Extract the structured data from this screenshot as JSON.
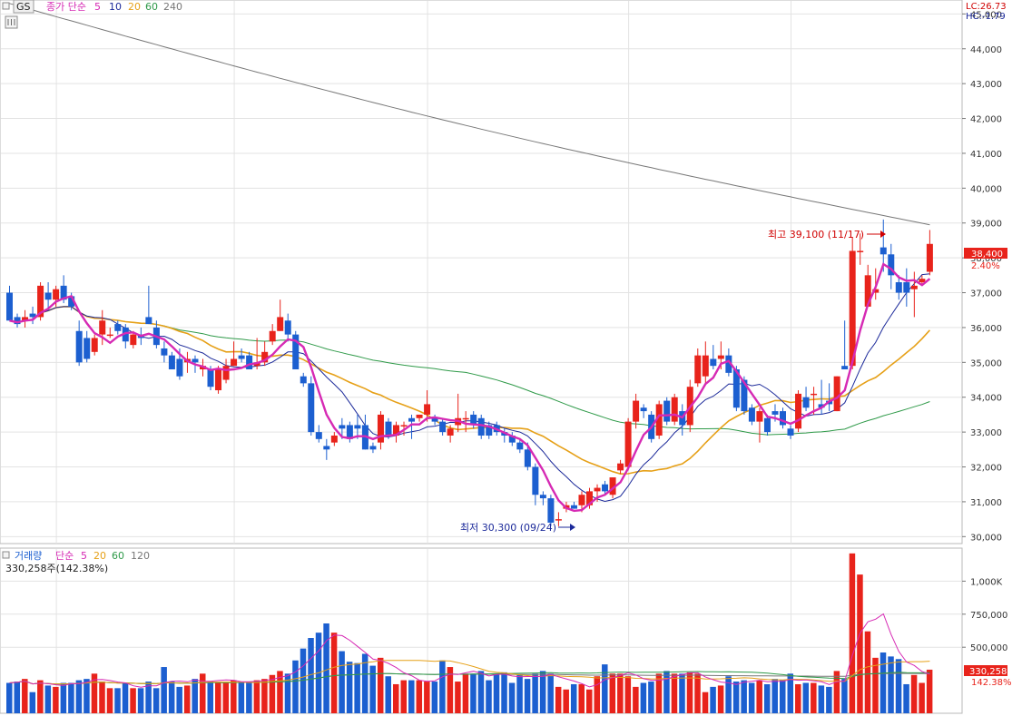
{
  "price_panel": {
    "code_label": "GS",
    "ma_prefix": "종가 단순",
    "ma_periods": [
      "5",
      "10",
      "20",
      "60",
      "240"
    ],
    "lc_label": "LC:26.73",
    "hc_label": "HC:-1.79",
    "current_price_label": "38,400",
    "change_label": "2.40%",
    "high_annotation": "최고 39,100 (11/17)",
    "low_annotation": "최저 30,300 (09/24)",
    "y_ticks": [
      "30,000",
      "31,000",
      "32,000",
      "33,000",
      "34,000",
      "35,000",
      "36,000",
      "37,000",
      "38,000",
      "39,000",
      "40,000",
      "41,000",
      "42,000",
      "43,000",
      "44,000",
      "45,000"
    ]
  },
  "volume_panel": {
    "title": "거래량",
    "ma_prefix": "단순",
    "ma_periods": [
      "5",
      "20",
      "60",
      "120"
    ],
    "current_volume_text": "330,258주(142.38%)",
    "current_volume_label": "330,258",
    "volume_ratio_label": "142.38%",
    "y_ticks": [
      "500,000",
      "750,000",
      "1,000K"
    ]
  },
  "colors": {
    "up": "#e8231b",
    "down": "#1c5fd0",
    "ma5": "#d62ab4",
    "ma10": "#1c2a9a",
    "ma20": "#e6a017",
    "ma60": "#2f9a49",
    "ma240": "#777777",
    "grid": "#e3e3e3"
  },
  "chart_data": [
    {
      "type": "candlestick",
      "y_scale": "price (KRW)",
      "ylim": [
        29800,
        45400
      ],
      "grid": true,
      "candles": [
        [
          37000,
          37200,
          36300,
          36200
        ],
        [
          36300,
          36400,
          36000,
          36100
        ],
        [
          36200,
          36500,
          36000,
          36300
        ],
        [
          36400,
          36600,
          36100,
          36300
        ],
        [
          36300,
          37300,
          36200,
          37200
        ],
        [
          37000,
          37300,
          36500,
          36800
        ],
        [
          36800,
          37200,
          36600,
          37100
        ],
        [
          37200,
          37500,
          36700,
          36800
        ],
        [
          36900,
          37000,
          36500,
          36600
        ],
        [
          35900,
          36200,
          34900,
          35000
        ],
        [
          35700,
          35900,
          35000,
          35100
        ],
        [
          35300,
          35800,
          35200,
          35700
        ],
        [
          35800,
          36500,
          35500,
          36200
        ],
        [
          35800,
          36000,
          35700,
          35800
        ],
        [
          36100,
          36200,
          35800,
          35900
        ],
        [
          36000,
          36100,
          35400,
          35600
        ],
        [
          35500,
          35900,
          35400,
          35800
        ],
        [
          35800,
          36000,
          35500,
          35700
        ],
        [
          36300,
          37200,
          36100,
          36100
        ],
        [
          36000,
          36200,
          35400,
          35500
        ],
        [
          35400,
          35600,
          35000,
          35200
        ],
        [
          35200,
          35300,
          34800,
          34800
        ],
        [
          35100,
          35400,
          34500,
          34600
        ],
        [
          35000,
          35300,
          34700,
          35100
        ],
        [
          35100,
          35200,
          34700,
          35000
        ],
        [
          34800,
          35100,
          34600,
          34900
        ],
        [
          34800,
          34900,
          34200,
          34300
        ],
        [
          34200,
          34900,
          34100,
          34800
        ],
        [
          34500,
          35100,
          34400,
          34900
        ],
        [
          34900,
          35600,
          34900,
          35100
        ],
        [
          35200,
          35400,
          35000,
          35100
        ],
        [
          35200,
          35300,
          34800,
          34800
        ],
        [
          34900,
          35700,
          34800,
          35000
        ],
        [
          35000,
          35600,
          34900,
          35300
        ],
        [
          35600,
          36100,
          35500,
          35900
        ],
        [
          35900,
          36800,
          35900,
          36300
        ],
        [
          36200,
          36400,
          35600,
          35800
        ],
        [
          35800,
          35900,
          34800,
          34800
        ],
        [
          34600,
          34700,
          34300,
          34400
        ],
        [
          34400,
          34600,
          32900,
          33000
        ],
        [
          33000,
          33200,
          32700,
          32800
        ],
        [
          32600,
          32800,
          32200,
          32500
        ],
        [
          32700,
          33000,
          32600,
          32900
        ],
        [
          33200,
          33400,
          32800,
          33100
        ],
        [
          33200,
          33300,
          32700,
          32800
        ],
        [
          33200,
          33500,
          32800,
          33100
        ],
        [
          33200,
          33500,
          32500,
          32500
        ],
        [
          32600,
          32700,
          32400,
          32500
        ],
        [
          32700,
          33600,
          32500,
          33500
        ],
        [
          33300,
          33400,
          32800,
          32900
        ],
        [
          32900,
          33300,
          32700,
          33200
        ],
        [
          33200,
          33300,
          32900,
          33200
        ],
        [
          33400,
          33500,
          32800,
          33300
        ],
        [
          33400,
          33500,
          33300,
          33500
        ],
        [
          33500,
          34200,
          33300,
          33800
        ],
        [
          33400,
          33500,
          33200,
          33300
        ],
        [
          33300,
          33400,
          32900,
          33000
        ],
        [
          32900,
          33200,
          32700,
          33100
        ],
        [
          33200,
          34100,
          33000,
          33400
        ],
        [
          33400,
          33600,
          33000,
          33400
        ],
        [
          33500,
          33600,
          33100,
          33200
        ],
        [
          33400,
          33500,
          32800,
          32900
        ],
        [
          33200,
          33300,
          32800,
          32900
        ],
        [
          33200,
          33300,
          32900,
          33000
        ],
        [
          33000,
          33100,
          32700,
          32900
        ],
        [
          32900,
          33000,
          32600,
          32700
        ],
        [
          32700,
          32800,
          32400,
          32500
        ],
        [
          32500,
          32700,
          31900,
          32000
        ],
        [
          32000,
          32100,
          30900,
          31200
        ],
        [
          31200,
          31300,
          30900,
          31100
        ],
        [
          31100,
          31200,
          30300,
          30400
        ],
        [
          30500,
          30700,
          30300,
          30500
        ],
        [
          30800,
          31000,
          30700,
          30900
        ],
        [
          30900,
          31000,
          30800,
          30800
        ],
        [
          30900,
          31300,
          30700,
          31200
        ],
        [
          30900,
          31400,
          30800,
          31300
        ],
        [
          31300,
          31500,
          31000,
          31400
        ],
        [
          31500,
          31600,
          31200,
          31300
        ],
        [
          31200,
          31700,
          31100,
          31700
        ],
        [
          31900,
          32200,
          31800,
          32100
        ],
        [
          32000,
          33400,
          31900,
          33300
        ],
        [
          33300,
          34100,
          33100,
          33900
        ],
        [
          33700,
          33800,
          33400,
          33600
        ],
        [
          33500,
          33600,
          32700,
          32800
        ],
        [
          32900,
          33900,
          32800,
          33800
        ],
        [
          33900,
          34000,
          33200,
          33300
        ],
        [
          33300,
          34100,
          33200,
          34000
        ],
        [
          33600,
          33800,
          32900,
          33200
        ],
        [
          33200,
          34500,
          33000,
          34300
        ],
        [
          34400,
          35400,
          34300,
          35200
        ],
        [
          34600,
          35600,
          34400,
          35200
        ],
        [
          35100,
          35500,
          34800,
          34900
        ],
        [
          35100,
          35600,
          34800,
          35200
        ],
        [
          35200,
          35400,
          34600,
          34700
        ],
        [
          34800,
          34900,
          33600,
          33700
        ],
        [
          34500,
          34600,
          33500,
          33600
        ],
        [
          33700,
          33800,
          33200,
          33300
        ],
        [
          33300,
          33700,
          32700,
          33600
        ],
        [
          33400,
          33500,
          32900,
          33000
        ],
        [
          33600,
          33800,
          33300,
          33500
        ],
        [
          33600,
          33700,
          33100,
          33200
        ],
        [
          33100,
          33200,
          32800,
          32900
        ],
        [
          33100,
          34200,
          33000,
          34100
        ],
        [
          34000,
          34300,
          33600,
          33700
        ],
        [
          34100,
          34300,
          33500,
          34100
        ],
        [
          33800,
          34500,
          33500,
          33700
        ],
        [
          33900,
          34400,
          33600,
          33800
        ],
        [
          33600,
          34600,
          33600,
          34600
        ],
        [
          34900,
          36200,
          34800,
          34800
        ],
        [
          34900,
          38600,
          34800,
          38200
        ],
        [
          38200,
          38700,
          37800,
          38200
        ],
        [
          36600,
          37800,
          36600,
          37500
        ],
        [
          37000,
          37700,
          36800,
          37100
        ],
        [
          38300,
          39100,
          37600,
          38100
        ],
        [
          38100,
          38400,
          37100,
          37500
        ],
        [
          37300,
          37500,
          36800,
          37000
        ],
        [
          37300,
          37700,
          36600,
          37000
        ],
        [
          37100,
          37600,
          36300,
          37200
        ],
        [
          37300,
          37500,
          37200,
          37400
        ],
        [
          37600,
          38800,
          37500,
          38400
        ]
      ],
      "annotations": [
        {
          "text": "최고 39,100 (11/17)",
          "price": 39100
        },
        {
          "text": "최저 30,300 (09/24)",
          "price": 30300
        }
      ]
    },
    {
      "type": "bar",
      "y_scale": "volume (shares)",
      "ylim": [
        0,
        1250000
      ],
      "grid": true,
      "values": [
        230000,
        240000,
        260000,
        160000,
        250000,
        210000,
        200000,
        230000,
        230000,
        250000,
        260000,
        300000,
        240000,
        190000,
        190000,
        230000,
        190000,
        190000,
        240000,
        190000,
        350000,
        240000,
        200000,
        210000,
        260000,
        300000,
        240000,
        230000,
        230000,
        250000,
        240000,
        240000,
        250000,
        260000,
        290000,
        320000,
        300000,
        400000,
        490000,
        570000,
        610000,
        680000,
        610000,
        470000,
        390000,
        380000,
        450000,
        360000,
        420000,
        280000,
        220000,
        250000,
        250000,
        250000,
        240000,
        240000,
        400000,
        350000,
        240000,
        300000,
        300000,
        320000,
        250000,
        300000,
        310000,
        230000,
        290000,
        260000,
        300000,
        320000,
        300000,
        200000,
        180000,
        220000,
        220000,
        180000,
        280000,
        370000,
        300000,
        300000,
        280000,
        200000,
        230000,
        240000,
        300000,
        320000,
        300000,
        300000,
        310000,
        300000,
        160000,
        200000,
        210000,
        280000,
        240000,
        250000,
        230000,
        250000,
        220000,
        260000,
        250000,
        300000,
        220000,
        230000,
        230000,
        210000,
        200000,
        320000,
        260000,
        1210000,
        1050000,
        620000,
        420000,
        460000,
        430000,
        410000,
        220000,
        290000,
        230000,
        330000
      ],
      "up_down": "same colors as price candles (red = close >= open, blue = close < open)"
    }
  ]
}
